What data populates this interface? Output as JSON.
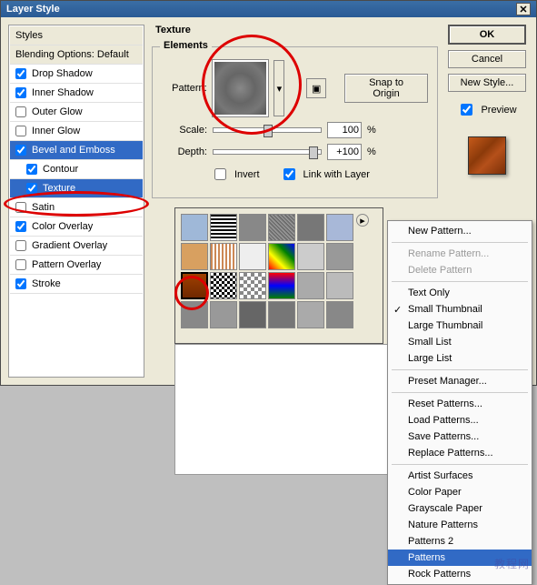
{
  "title": "Layer Style",
  "styles": {
    "header": "Styles",
    "blending": "Blending Options: Default",
    "items": [
      {
        "label": "Drop Shadow",
        "checked": true
      },
      {
        "label": "Inner Shadow",
        "checked": true
      },
      {
        "label": "Outer Glow",
        "checked": false
      },
      {
        "label": "Inner Glow",
        "checked": false
      },
      {
        "label": "Bevel and Emboss",
        "checked": true,
        "selected": true
      },
      {
        "label": "Contour",
        "checked": true,
        "indent": true
      },
      {
        "label": "Texture",
        "checked": true,
        "indent": true,
        "selected": true
      },
      {
        "label": "Satin",
        "checked": false
      },
      {
        "label": "Color Overlay",
        "checked": true
      },
      {
        "label": "Gradient Overlay",
        "checked": false
      },
      {
        "label": "Pattern Overlay",
        "checked": false
      },
      {
        "label": "Stroke",
        "checked": true
      }
    ]
  },
  "texture": {
    "group_label": "Texture",
    "elements_label": "Elements",
    "pattern_label": "Pattern:",
    "snap_label": "Snap to Origin",
    "scale_label": "Scale:",
    "scale_value": "100",
    "scale_unit": "%",
    "depth_label": "Depth:",
    "depth_value": "+100",
    "depth_unit": "%",
    "invert_label": "Invert",
    "link_label": "Link with Layer"
  },
  "buttons": {
    "ok": "OK",
    "cancel": "Cancel",
    "new_style": "New Style...",
    "preview": "Preview"
  },
  "menu": {
    "new_pattern": "New Pattern...",
    "rename": "Rename Pattern...",
    "delete": "Delete Pattern",
    "text_only": "Text Only",
    "small_thumb": "Small Thumbnail",
    "large_thumb": "Large Thumbnail",
    "small_list": "Small List",
    "large_list": "Large List",
    "preset_mgr": "Preset Manager...",
    "reset": "Reset Patterns...",
    "load": "Load Patterns...",
    "save": "Save Patterns...",
    "replace": "Replace Patterns...",
    "artist": "Artist Surfaces",
    "color_paper": "Color Paper",
    "grayscale": "Grayscale Paper",
    "nature": "Nature Patterns",
    "patterns2": "Patterns 2",
    "patterns": "Patterns",
    "rock": "Rock Patterns"
  },
  "watermark": "教程网"
}
